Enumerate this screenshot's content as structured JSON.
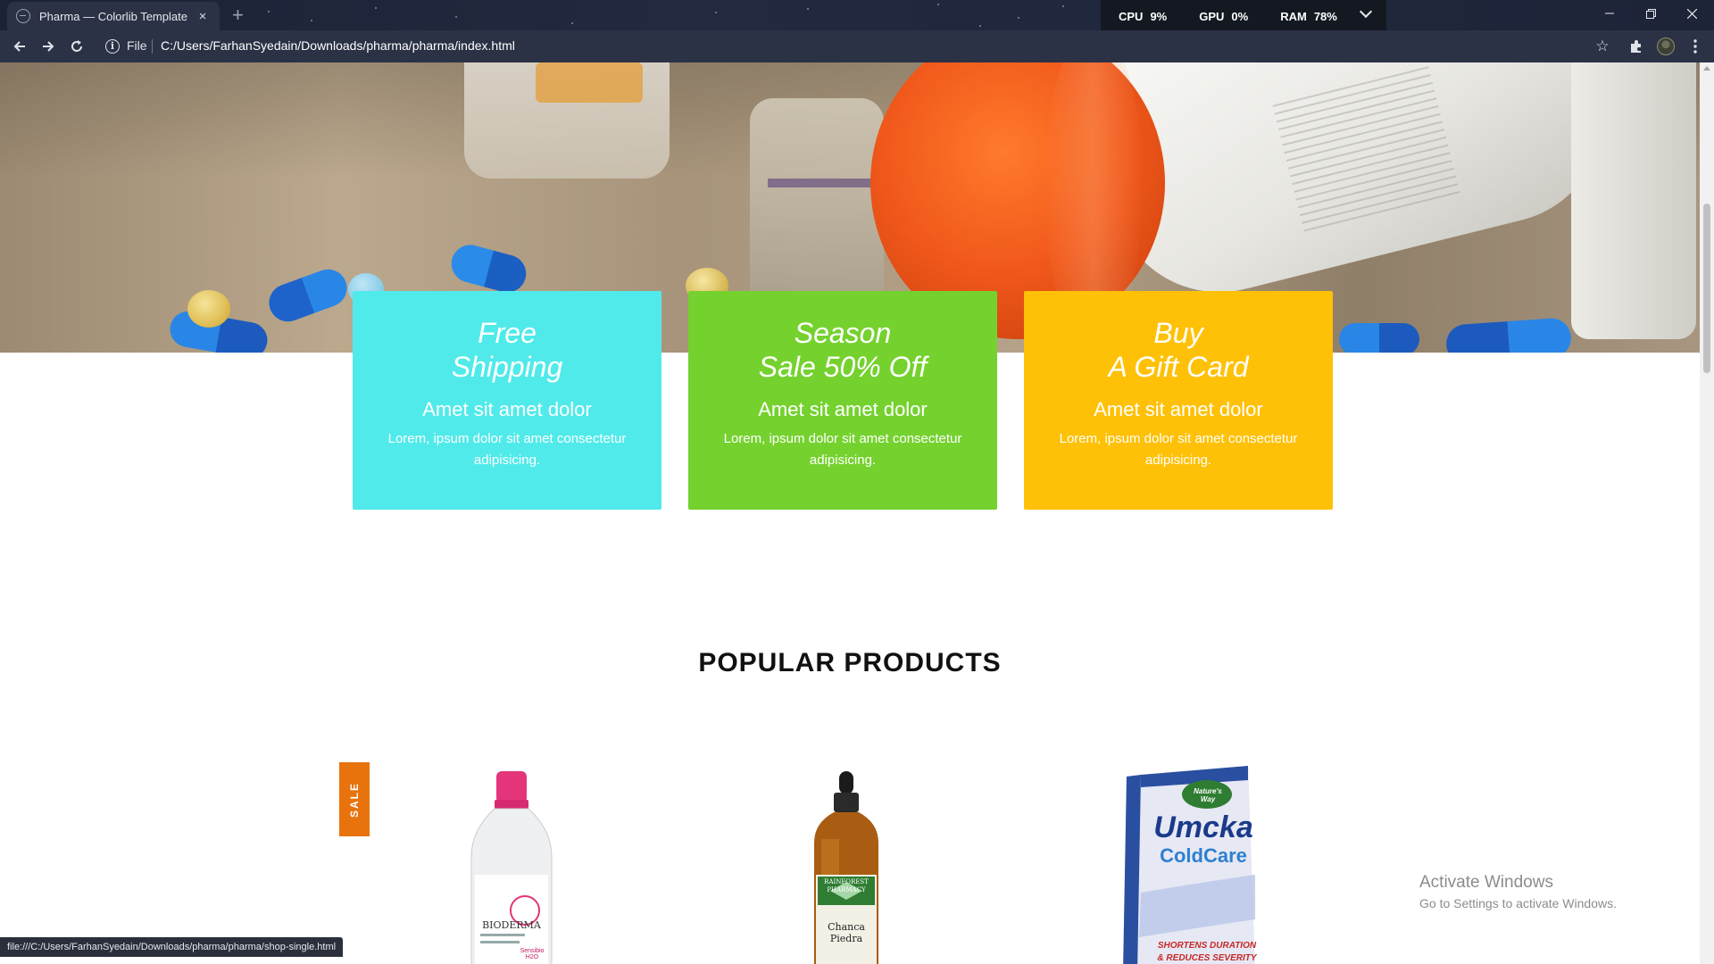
{
  "browser": {
    "tab_title": "Pharma — Colorlib Template",
    "tab_close": "×",
    "new_tab": "+",
    "scheme": "File",
    "url": "C:/Users/FarhanSyedain/Downloads/pharma/pharma/index.html",
    "status_url": "file:///C:/Users/FarhanSyedain/Downloads/pharma/pharma/shop-single.html"
  },
  "perf": {
    "cpu_label": "CPU",
    "cpu_value": "9%",
    "gpu_label": "GPU",
    "gpu_value": "0%",
    "ram_label": "RAM",
    "ram_value": "78%"
  },
  "features": [
    {
      "title_line1": "Free",
      "title_line2": "Shipping",
      "heading": "Amet sit amet dolor",
      "desc": "Lorem, ipsum dolor sit amet consectetur adipisicing.",
      "color": "#51eaea"
    },
    {
      "title_line1": "Season",
      "title_line2": "Sale 50% Off",
      "heading": "Amet sit amet dolor",
      "desc": "Lorem, ipsum dolor sit amet consectetur adipisicing.",
      "color": "#75d22e"
    },
    {
      "title_line1": "Buy",
      "title_line2": "A Gift Card",
      "heading": "Amet sit amet dolor",
      "desc": "Lorem, ipsum dolor sit amet consectetur adipisicing.",
      "color": "#ffc107"
    }
  ],
  "popular": {
    "title": "POPULAR PRODUCTS",
    "sale_badge": "SALE",
    "products": [
      {
        "label_brand": "BIODERMA",
        "label_line": "Sensibio H2O"
      },
      {
        "label_brand": "RAINFOREST PHARMACY",
        "label_line": "Chanca Piedra"
      },
      {
        "label_brand": "Nature's Way",
        "label_line": "Umcka",
        "label_sub": "ColdCare",
        "label_claim1": "SHORTENS DURATION",
        "label_claim2": "& REDUCES SEVERITY"
      }
    ]
  },
  "watermark": {
    "line1": "Activate Windows",
    "line2": "Go to Settings to activate Windows."
  }
}
